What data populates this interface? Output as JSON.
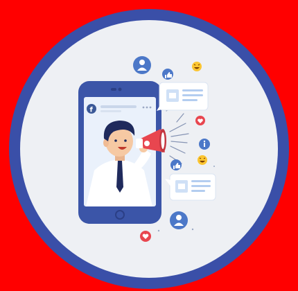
{
  "colors": {
    "background": "#ff0000",
    "ring": "#3a4fa8",
    "circle_fill": "#eef0f4",
    "phone_body": "#3b55a8",
    "screen": "#eaf1fb",
    "facebook_blue": "#3b5998",
    "megaphone_red": "#e8464f",
    "like_blue": "#4c78c8",
    "heart_red": "#e8464f",
    "emoji_yellow": "#fbc531",
    "card_line_blue": "#b3cdf0",
    "shirt": "#ffffff",
    "tie": "#1f2a5c",
    "hair": "#1f2a5c",
    "skin": "#f6c9a3"
  },
  "icons": {
    "brand": "facebook-logo-icon",
    "post_menu": "ellipsis-icon",
    "user": "user-profile-icon",
    "like": "thumbs-up-icon",
    "love": "heart-icon",
    "laugh": "laughing-emoji-icon",
    "info": "info-icon",
    "broadcast": "megaphone-icon",
    "card_store": "store-icon"
  }
}
